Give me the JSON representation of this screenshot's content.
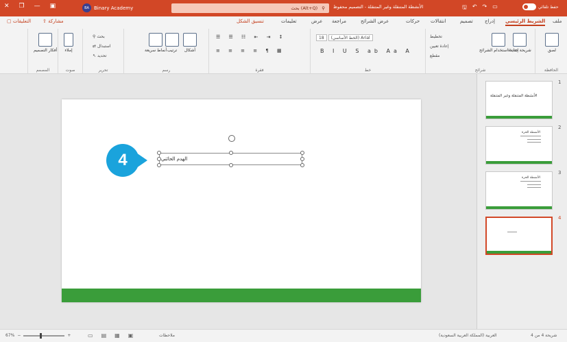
{
  "titlebar": {
    "autosave_label": "حفظ تلقائي",
    "document_title": "الأنشطة المتنقلة وغير المتنقلة - التصميم محفوظ",
    "search_placeholder": "بحث (Alt+Q)",
    "account_initials": "BA",
    "account_name": "Binary Academy"
  },
  "tabs": {
    "file": "ملف",
    "home": "الشريط الرئيسي",
    "insert": "إدراج",
    "design": "تصميم",
    "transitions": "انتقالات",
    "animations": "حركات",
    "slideshow": "عرض الشرائح",
    "review": "مراجعة",
    "view": "عرض",
    "help": "تعليمات",
    "shape_format": "تنسيق الشكل",
    "share": "مشاركة",
    "comments": "التعليقات"
  },
  "ribbon": {
    "clipboard": {
      "label": "الحافظة",
      "paste": "لصق"
    },
    "slides": {
      "label": "شرائح",
      "new_slide": "شريحة جديدة",
      "reuse": "إعادة استخدام الشرائح",
      "layout": "تخطيط",
      "reset": "إعادة تعيين",
      "section": "مقطع"
    },
    "font": {
      "label": "خط",
      "font_name": "(الخط الأساسي) Arial",
      "font_size": "18"
    },
    "paragraph": {
      "label": "فقرة"
    },
    "drawing": {
      "label": "رسم",
      "shapes": "أشكال",
      "arrange": "ترتيب",
      "quick_styles": "أنماط سريعة"
    },
    "editing": {
      "label": "تحرير",
      "find": "بحث",
      "replace": "استبدال",
      "select": "تحديد"
    },
    "voice": {
      "label": "صوت",
      "dictate": "إملاء"
    },
    "designer": {
      "label": "المصمم",
      "design_ideas": "أفكار التصميم"
    }
  },
  "slide": {
    "textbox_text": "الهدم الحائني",
    "callout_number": "4"
  },
  "thumbnails": {
    "items": [
      {
        "number": "1",
        "title": "الأنشطة المتنقلة وغير المتنقلة"
      },
      {
        "number": "2",
        "title": "الأنشطة الحرة"
      },
      {
        "number": "3",
        "title": "الأنشطة الحرة"
      },
      {
        "number": "4",
        "title": ""
      }
    ]
  },
  "statusbar": {
    "zoom": "67%",
    "notes": "ملاحظات",
    "language": "العربية (المملكة العربية السعودية)",
    "slide_count": "شريحة 4 من 4"
  },
  "colors": {
    "accent": "#d24726",
    "slide_band": "#3a9d3a",
    "callout": "#1aa3dc"
  }
}
